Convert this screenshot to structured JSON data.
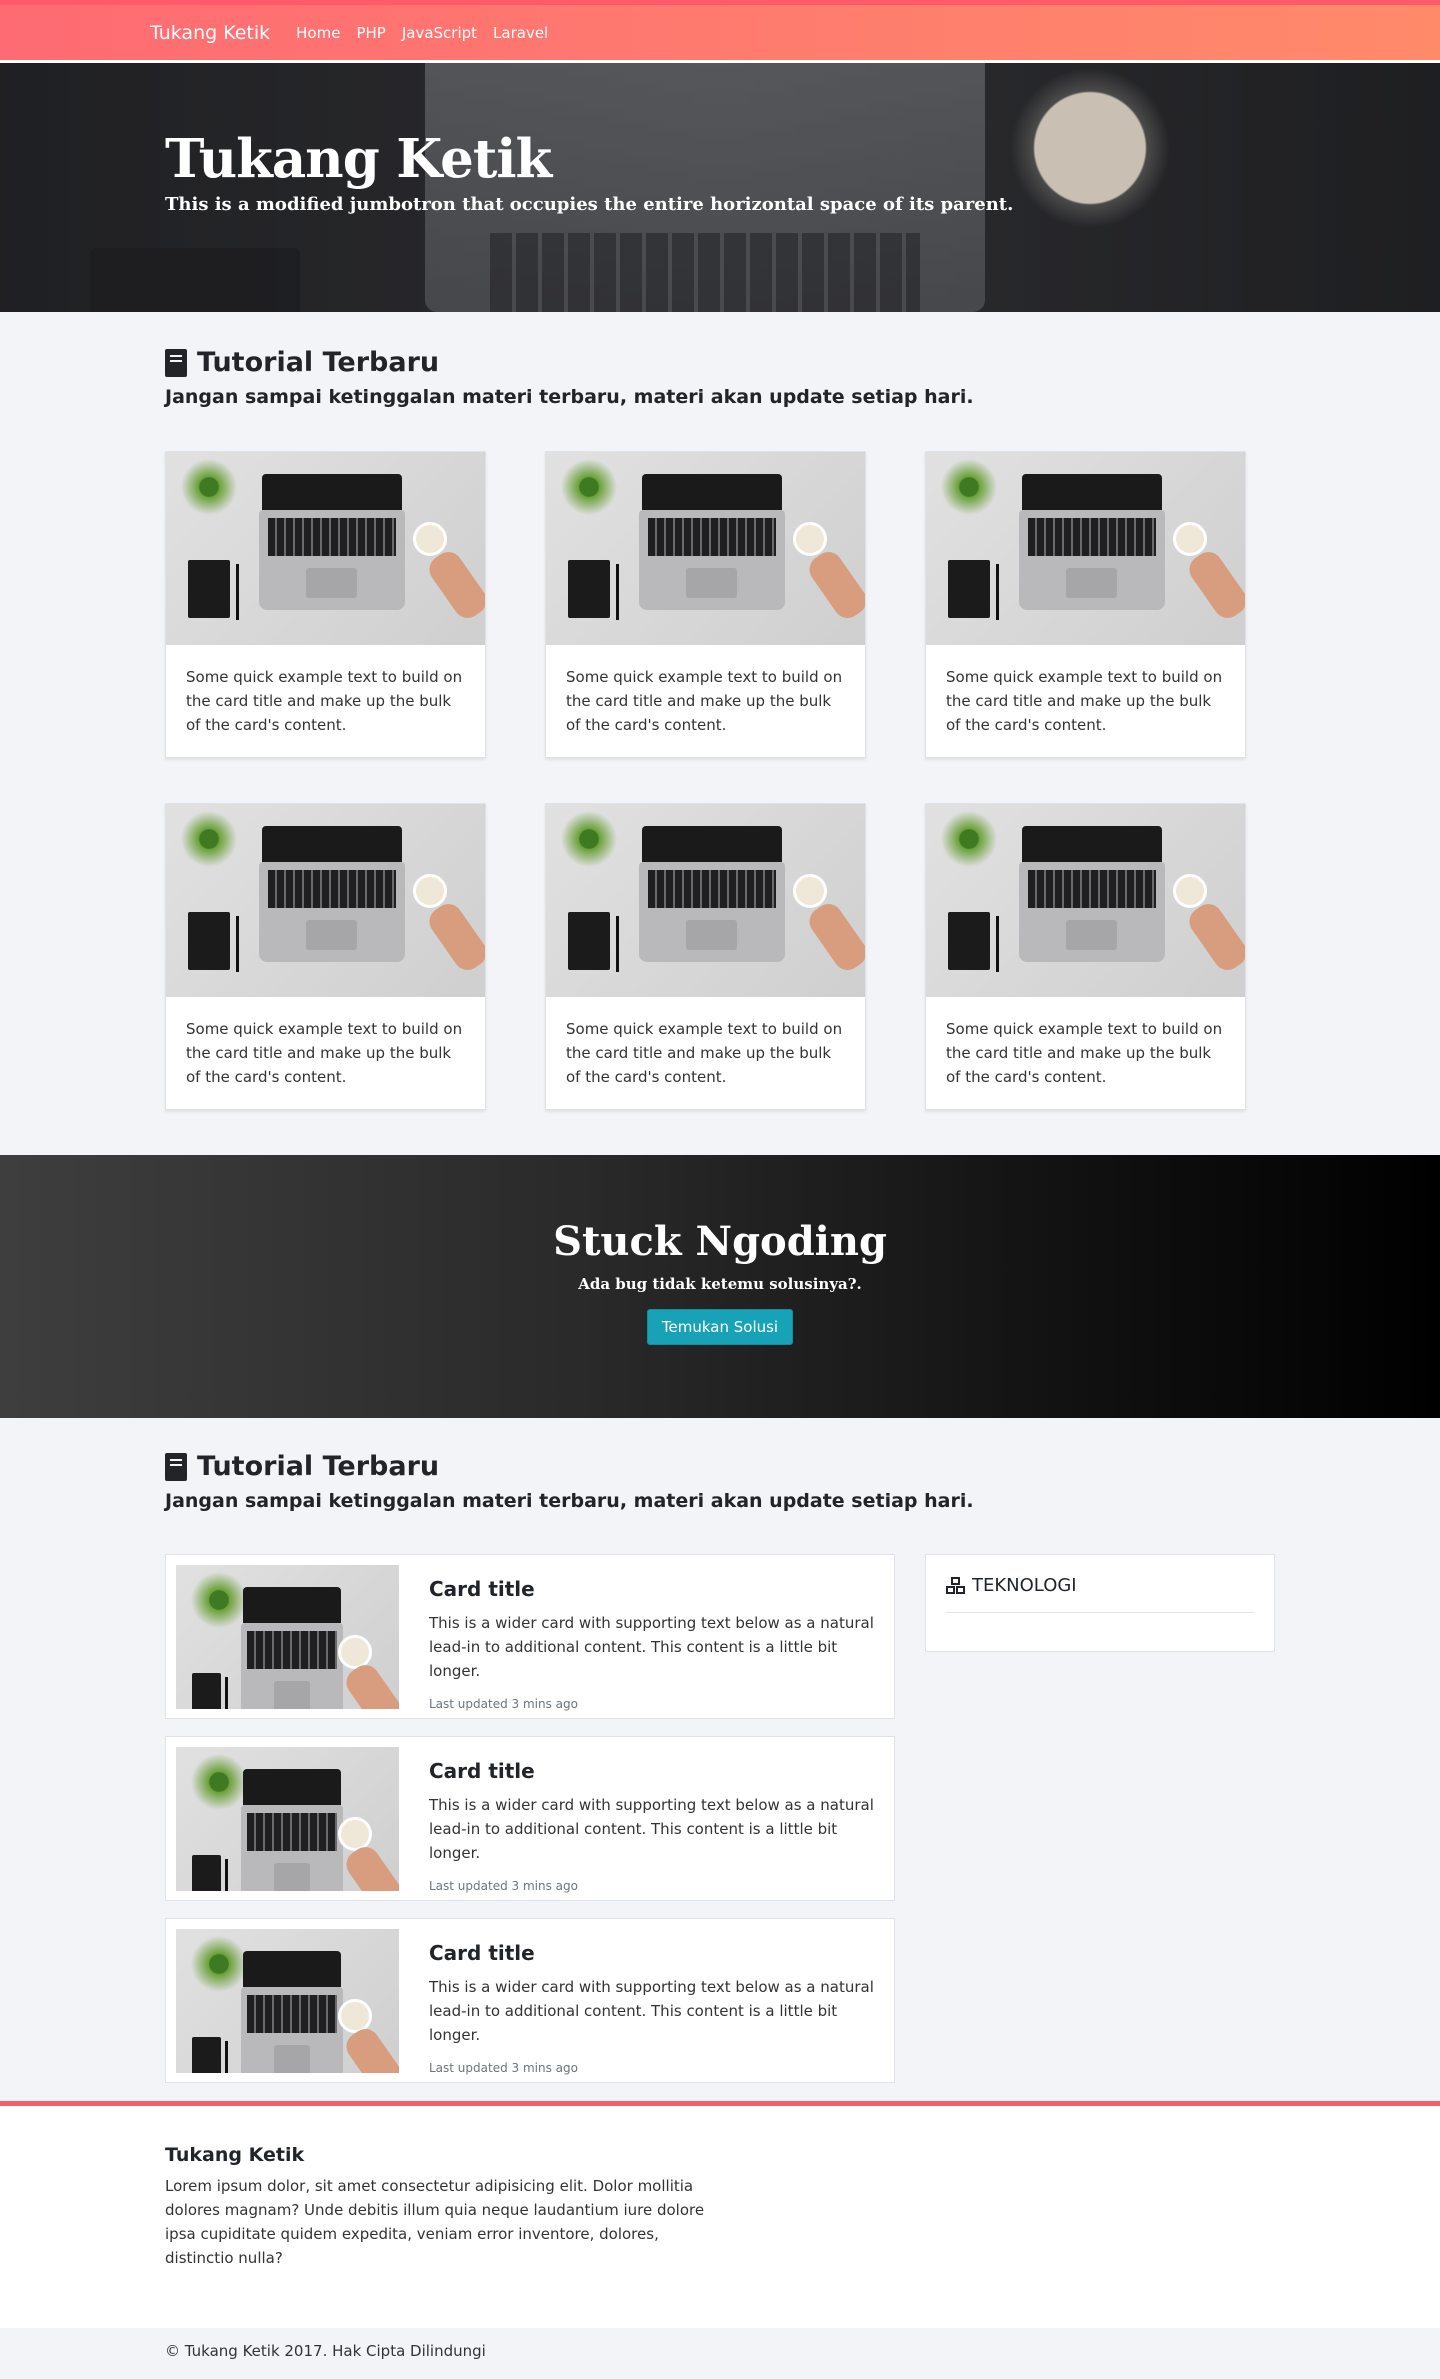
{
  "nav": {
    "brand": "Tukang Ketik",
    "links": [
      "Home",
      "PHP",
      "JavaScript",
      "Laravel"
    ]
  },
  "hero": {
    "title": "Tukang Ketik",
    "subtitle": "This is a modified jumbotron that occupies the entire horizontal space of its parent."
  },
  "section1": {
    "title": "Tutorial Terbaru",
    "subtitle": "Jangan sampai ketinggalan materi terbaru, materi akan update setiap hari.",
    "cards": [
      {
        "text": "Some quick example text to build on the card title and make up the bulk of the card's content."
      },
      {
        "text": "Some quick example text to build on the card title and make up the bulk of the card's content."
      },
      {
        "text": "Some quick example text to build on the card title and make up the bulk of the card's content."
      },
      {
        "text": "Some quick example text to build on the card title and make up the bulk of the card's content."
      },
      {
        "text": "Some quick example text to build on the card title and make up the bulk of the card's content."
      },
      {
        "text": "Some quick example text to build on the card title and make up the bulk of the card's content."
      }
    ]
  },
  "cta": {
    "title": "Stuck Ngoding",
    "subtitle": "Ada bug tidak ketemu solusinya?.",
    "button": "Temukan Solusi"
  },
  "section2": {
    "title": "Tutorial Terbaru",
    "subtitle": "Jangan sampai ketinggalan materi terbaru, materi akan update setiap hari.",
    "items": [
      {
        "title": "Card title",
        "text": "This is a wider card with supporting text below as a natural lead-in to additional content. This content is a little bit longer.",
        "updated": "Last updated 3 mins ago"
      },
      {
        "title": "Card title",
        "text": "This is a wider card with supporting text below as a natural lead-in to additional content. This content is a little bit longer.",
        "updated": "Last updated 3 mins ago"
      },
      {
        "title": "Card title",
        "text": "This is a wider card with supporting text below as a natural lead-in to additional content. This content is a little bit longer.",
        "updated": "Last updated 3 mins ago"
      }
    ],
    "sidebar": {
      "title": "TEKNOLOGI",
      "icon": "cubes-icon"
    }
  },
  "footer": {
    "title": "Tukang Ketik",
    "text": "Lorem ipsum dolor, sit amet consectetur adipisicing elit. Dolor mollitia dolores magnam? Unde debitis illum quia neque laudantium iure dolore ipsa cupiditate quidem expedita, veniam error inventore, dolores, distinctio nulla?",
    "copyright": "© Tukang Ketik 2017. Hak Cipta Dilindungi"
  },
  "colors": {
    "nav_gradient_start": "#fe6b73",
    "nav_gradient_end": "#ff8a6a",
    "cta_button": "#17a2b8",
    "footer_accent": "#f25f6b"
  }
}
